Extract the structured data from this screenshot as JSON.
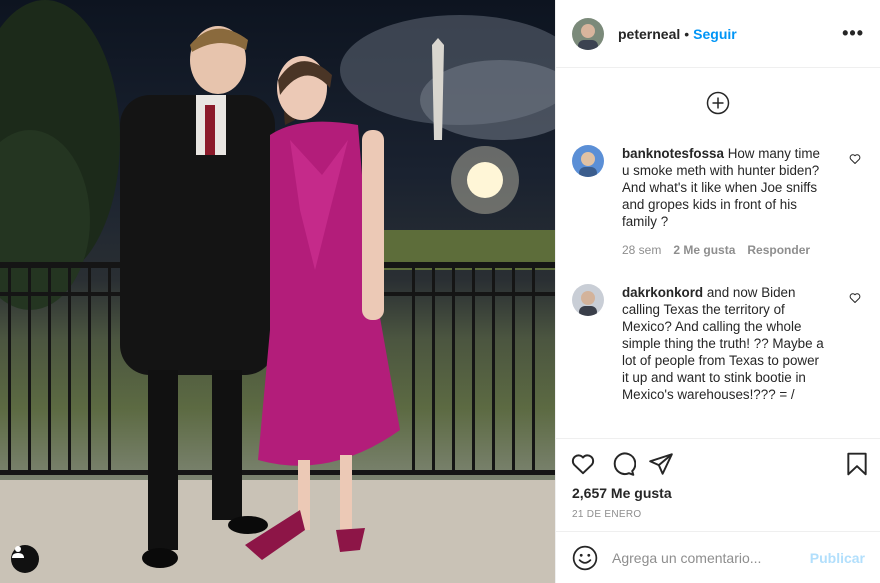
{
  "post": {
    "username": "peterneal",
    "separator": "•",
    "follow_label": "Seguir",
    "more_icon": "more-options-icon",
    "likes": "2,657 Me gusta",
    "date": "21 DE ENERO"
  },
  "comments": [
    {
      "username": "banknotesfossa",
      "text": "How many time u smoke meth with hunter biden? And what's it like when Joe sniffs and gropes kids in front of his family ?",
      "age": "28 sem",
      "likes": "2 Me gusta",
      "reply": "Responder"
    },
    {
      "username": "dakrkonkord",
      "text": "and now Biden calling Texas the territory of Mexico? And calling the whole simple thing the truth! ?? Maybe a lot of people from Texas to power it up and want to stink bootie in Mexico's warehouses!??? = /"
    }
  ],
  "composer": {
    "placeholder": "Agrega un comentario...",
    "publish_label": "Publicar"
  },
  "colors": {
    "accent": "#0095f6",
    "publish_disabled": "#b2dffc",
    "muted": "#8e8e8e"
  }
}
